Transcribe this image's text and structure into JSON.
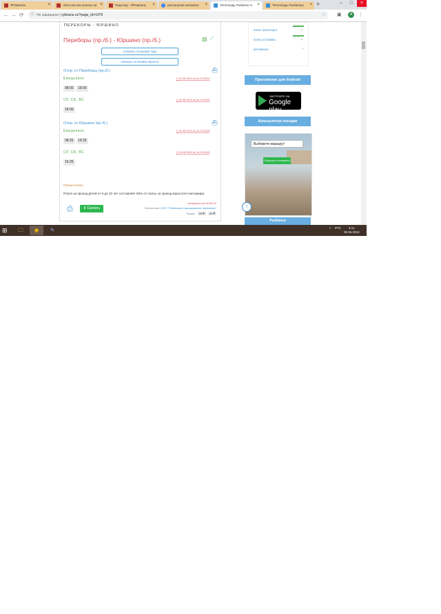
{
  "browser": {
    "tabs": [
      {
        "title": "ЯПомналь",
        "active": false
      },
      {
        "title": "«Без нее мы конецн на",
        "active": false
      },
      {
        "title": "Подслед › ЯПомналь",
        "active": false
      },
      {
        "title": "расписание москвоск",
        "active": false
      },
      {
        "title": "Теплоходь Рыбинск Н",
        "active": true
      },
      {
        "title": "Теплоходы Рыбинска",
        "active": false
      }
    ],
    "new_tab": "+",
    "close_tab_glyph": "×",
    "window_controls": {
      "minimize": "–",
      "maximize": "□",
      "close": "×"
    },
    "nav": {
      "back": "←",
      "forward": "→",
      "reload": "⟳"
    },
    "address": {
      "security": "Не защищено",
      "separator": "|",
      "url": "rybtrans.ru/?page_id=1079"
    },
    "star": "☆",
    "menu_dots": "⋮",
    "profile_letter": "А"
  },
  "page": {
    "heading": "ПЕРЕБОРЫ - ЮРШИНО",
    "route_title": "Переборы (пр./б.) - Юршино (пр./б.)",
    "buttons": {
      "show_stops_there": "показать остановки туда",
      "show_stops_back": "показать остановки обратно"
    },
    "sections": [
      {
        "departure": "Отпр. от Переборы (пр./б.)",
        "schedules": [
          {
            "days": "Ежедневно",
            "period": "С 01.05.2019 по 31.10.2019",
            "times": [
              "08:00",
              "19:00"
            ]
          },
          {
            "days": "СР, СБ, ВС",
            "period": "С 01.05.2019 по 31.10.2019",
            "times": [
              "16:00"
            ]
          }
        ]
      },
      {
        "departure": "Отпр. от Юршино (пр./б.)",
        "schedules": [
          {
            "days": "Ежедневно",
            "period": "С 01.05.2019 по 31.10.2019",
            "times": [
              "08:25",
              "19:25"
            ]
          },
          {
            "days": "СР, СБ, ВС",
            "period": "С 01.05.2019 по 31.10.2019",
            "times": [
              "16:25"
            ]
          }
        ]
      }
    ],
    "notes_title": "Примечания:",
    "notes_text": "Плата за проезд детей от 5 до 10 лет составляет 50% от платы за проезд взрослого пассажира.",
    "download_label": "Скачать",
    "actual_on": "Актуально на 30.06.19",
    "carrier_label": "Перевозчик:",
    "carrier_name": "ООО \"Рыбинское пассажирское перевозки\"",
    "tariff_label": "Тариф:",
    "tariffs": [
      "23 ₽",
      "23 ₽"
    ]
  },
  "sidebar": {
    "menu": [
      {
        "label": "поиск транспорта",
        "chevron": "⌄"
      },
      {
        "label": "поиск остановки",
        "chevron": "⌄"
      },
      {
        "label": "автовокзал",
        "chevron": "›"
      }
    ],
    "android_title": "Приложение для Android",
    "gplay_small": "ЗАГРУЗИТЕ НА",
    "gplay_big": "Google play",
    "calc_title": "Калькулятор поездки",
    "calc_select": "Выберите маршрут",
    "calc_button": "Получить стоимость",
    "rybinsk_title": "Рыбинск"
  },
  "taskbar": {
    "start": "⊞",
    "apps": [
      "🗀",
      "◉",
      "✎"
    ],
    "tray_arrow": "˄",
    "lang": "РУС",
    "time": "3:11",
    "date": "30.06.2019"
  },
  "colors": {
    "accent_blue": "#3a8fd0",
    "route_red": "#d9434f",
    "green": "#2db84f",
    "sidebar_head": "#68aee0"
  }
}
